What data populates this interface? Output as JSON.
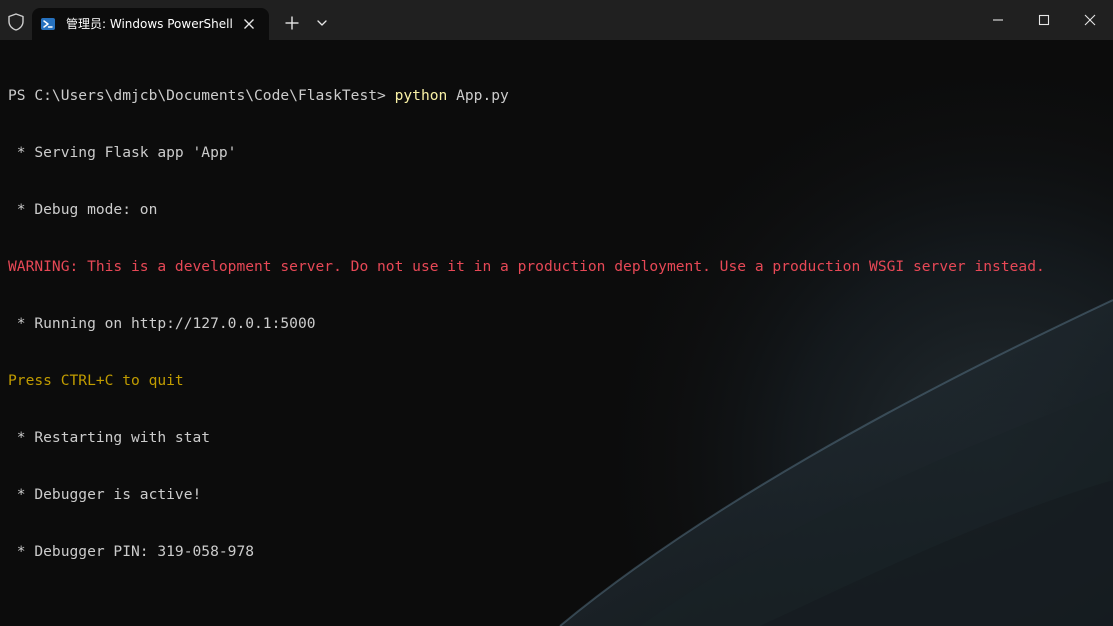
{
  "window": {
    "tab_title": "管理员: Windows PowerShell",
    "icons": {
      "shield": "shield-icon",
      "tab": "powershell-icon",
      "tab_close": "close-icon",
      "new_tab": "plus-icon",
      "dropdown": "chevron-down-icon",
      "minimize": "minimize-icon",
      "maximize": "maximize-icon",
      "close": "close-icon"
    }
  },
  "terminal": {
    "prompt": "PS C:\\Users\\dmjcb\\Documents\\Code\\FlaskTest> ",
    "command_name": "python",
    "command_args": " App.py",
    "lines": [
      " * Serving Flask app 'App'",
      " * Debug mode: on",
      "WARNING: This is a development server. Do not use it in a production deployment. Use a production WSGI server instead.",
      " * Running on http://127.0.0.1:5000",
      "Press CTRL+C to quit",
      " * Restarting with stat",
      " * Debugger is active!",
      " * Debugger PIN: 319-058-978"
    ]
  },
  "colors": {
    "background": "#0c0c0c",
    "titlebar": "#202020",
    "text": "#cccccc",
    "command": "#f9f1a5",
    "warning": "#e74856",
    "hint": "#c19c00"
  }
}
